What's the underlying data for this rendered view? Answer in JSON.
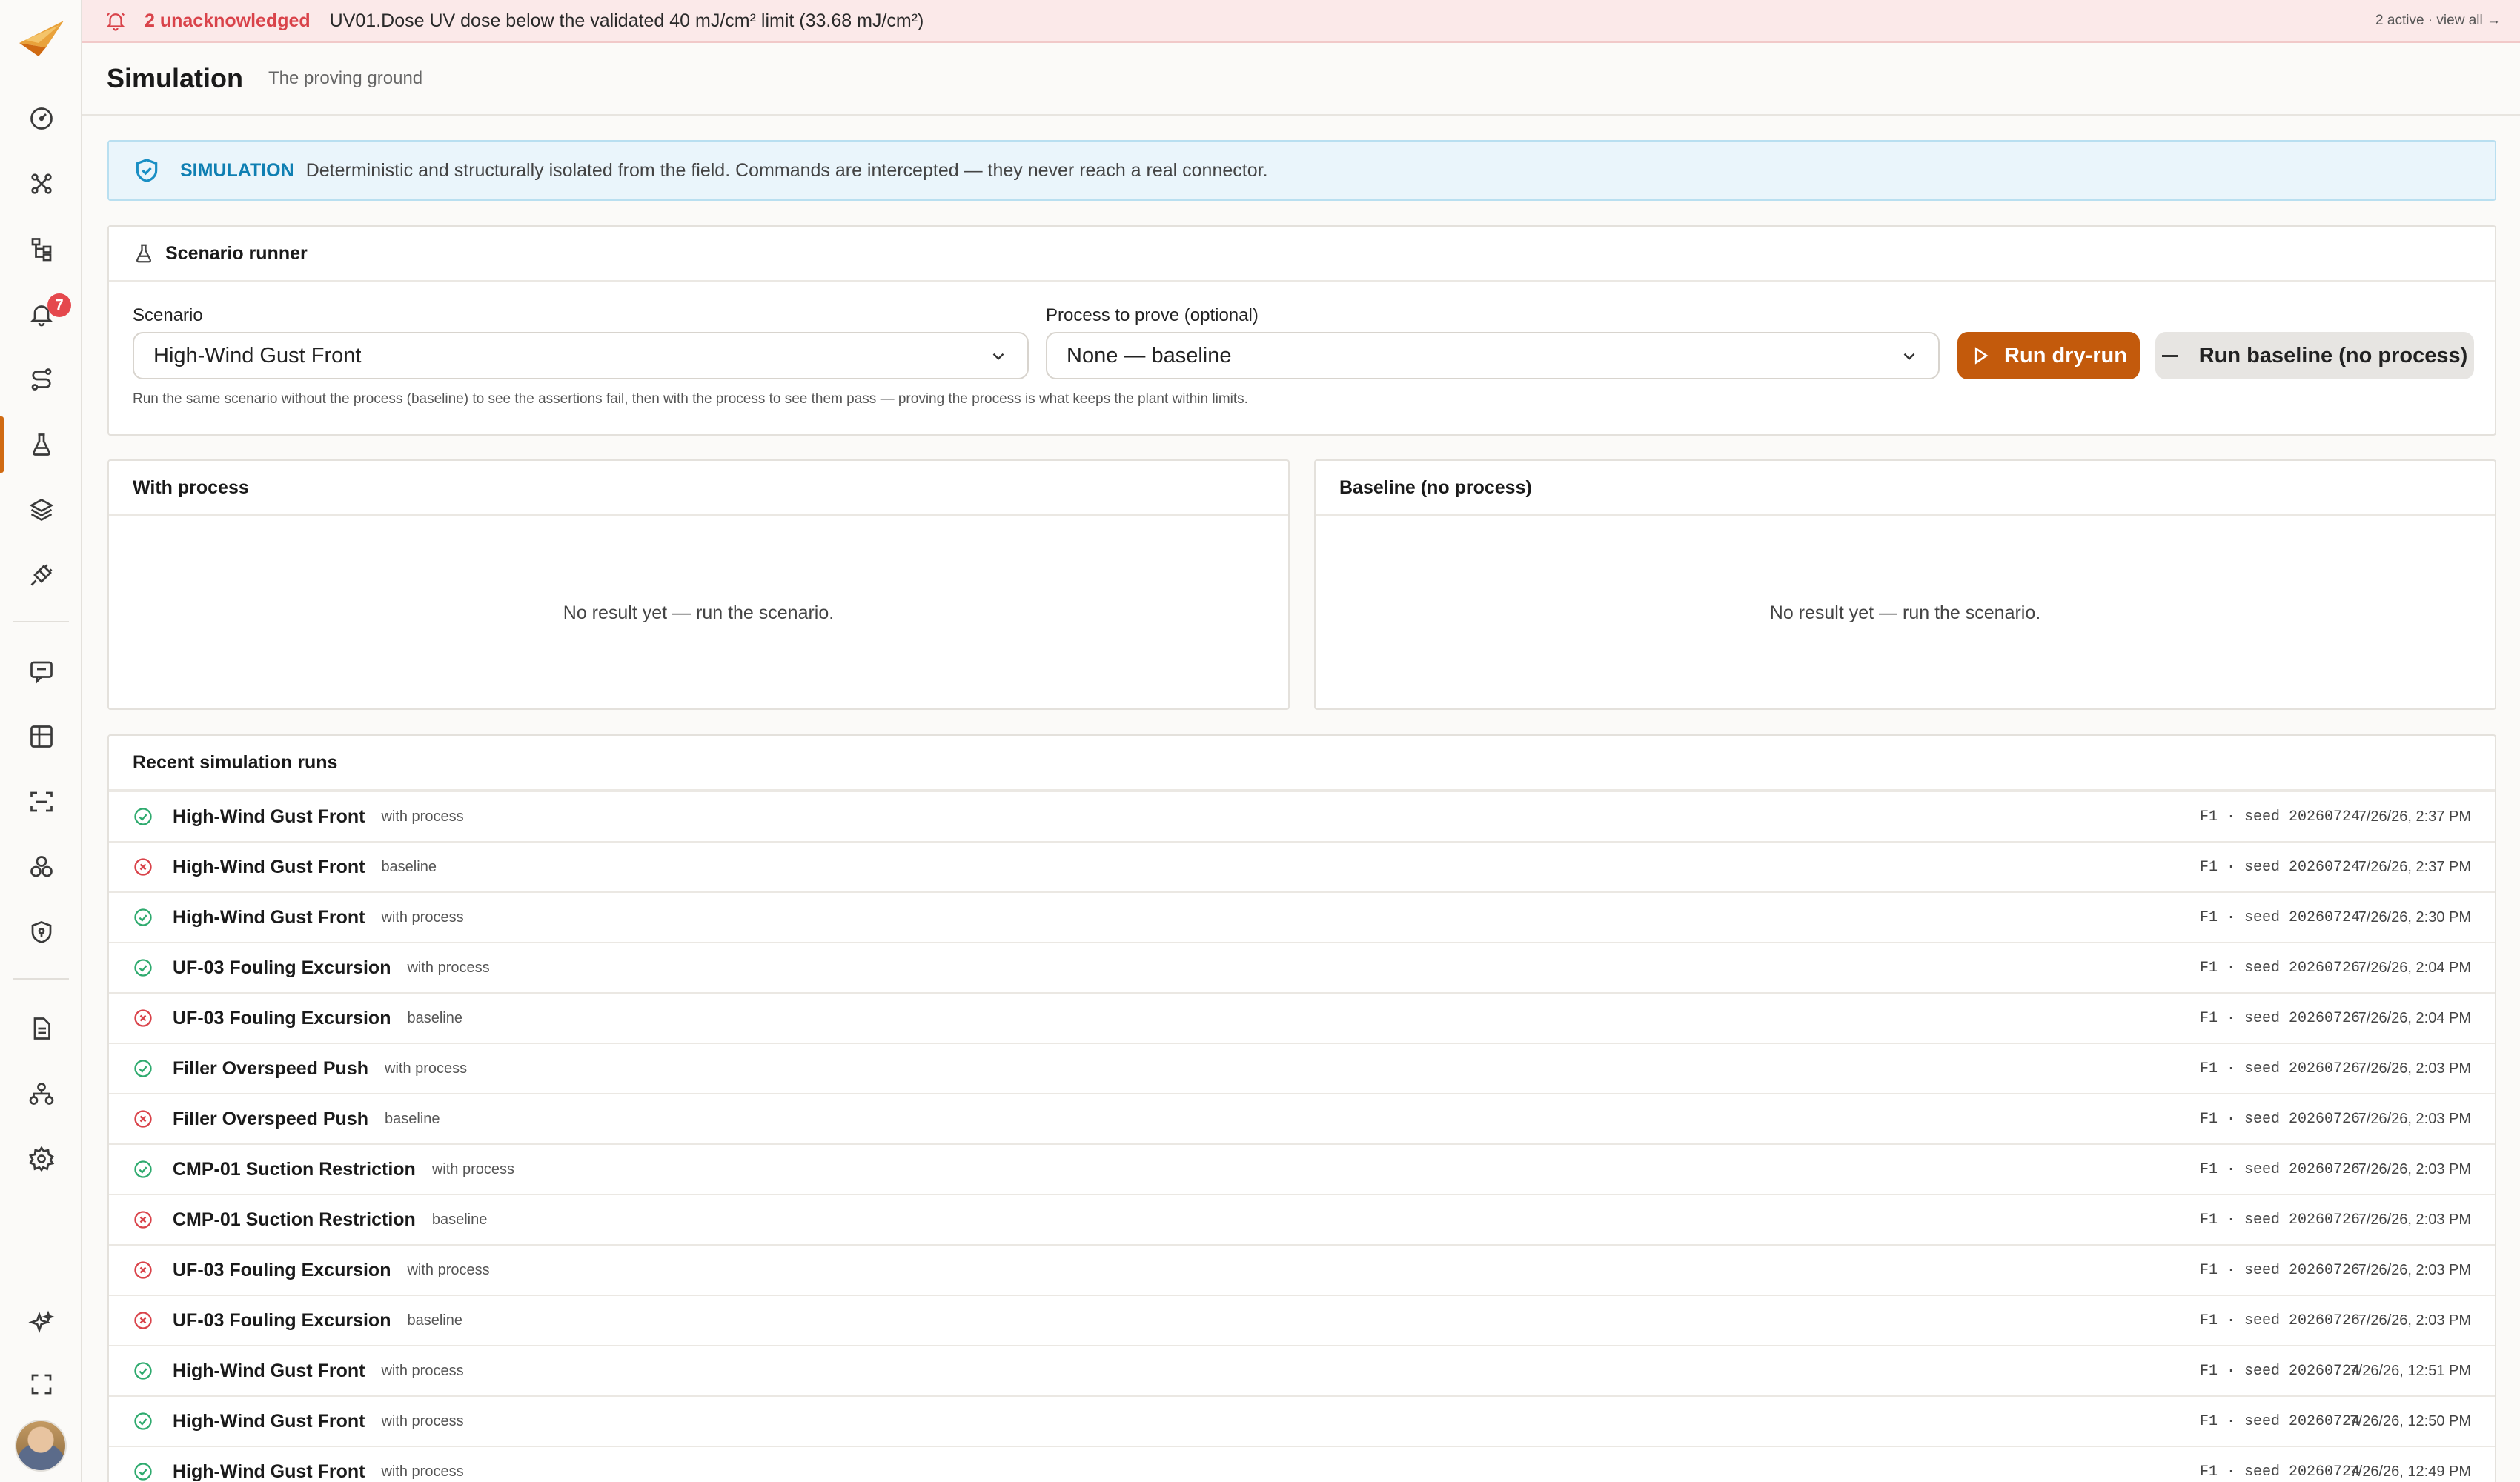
{
  "alert": {
    "count_label": "2 unacknowledged",
    "message": "UV01.Dose UV dose below the validated 40 mJ/cm² limit (33.68 mJ/cm²)",
    "right_label": "2 active · view all →"
  },
  "sidebar": {
    "items": [
      {
        "name": "dashboard",
        "icon": "gauge-icon"
      },
      {
        "name": "topology",
        "icon": "network-icon"
      },
      {
        "name": "process-tree",
        "icon": "hierarchy-icon"
      },
      {
        "name": "alarms",
        "icon": "bell-icon",
        "badge": "7"
      },
      {
        "name": "routes",
        "icon": "route-icon"
      },
      {
        "name": "simulation",
        "icon": "flask-icon",
        "active": true
      },
      {
        "name": "layers",
        "icon": "layers-icon"
      },
      {
        "name": "connectors",
        "icon": "plug-icon"
      },
      {
        "name": "chat",
        "icon": "chat-icon"
      },
      {
        "name": "tables",
        "icon": "grid-icon"
      },
      {
        "name": "scan",
        "icon": "scan-icon"
      },
      {
        "name": "components",
        "icon": "cubes-icon"
      },
      {
        "name": "security",
        "icon": "shield-icon"
      },
      {
        "name": "documents",
        "icon": "document-icon"
      },
      {
        "name": "org",
        "icon": "org-icon"
      },
      {
        "name": "settings",
        "icon": "gear-icon"
      },
      {
        "name": "ai",
        "icon": "sparkle-icon"
      },
      {
        "name": "fullscreen",
        "icon": "expand-icon"
      }
    ]
  },
  "header": {
    "title": "Simulation",
    "subtitle": "The proving ground"
  },
  "banner": {
    "tag": "SIMULATION",
    "text": "Deterministic and structurally isolated from the field. Commands are intercepted — they never reach a real connector."
  },
  "runner": {
    "title": "Scenario runner",
    "scenario_label": "Scenario",
    "scenario_value": "High-Wind Gust Front",
    "process_label": "Process to prove (optional)",
    "process_value": "None — baseline",
    "run_label": "Run dry-run",
    "baseline_label": "Run baseline (no process)",
    "hint": "Run the same scenario without the process (baseline) to see the assertions fail, then with the process to see them pass — proving the process is what keeps the plant within limits."
  },
  "with_process": {
    "title": "With process",
    "empty": "No result yet — run the scenario."
  },
  "baseline": {
    "title": "Baseline (no process)",
    "empty": "No result yet — run the scenario."
  },
  "runs": {
    "title": "Recent simulation runs",
    "rows": [
      {
        "status": "pass",
        "name": "High-Wind Gust Front",
        "mode": "with process",
        "seed": "F1 · seed 20260724",
        "time": "7/26/26, 2:37 PM"
      },
      {
        "status": "fail",
        "name": "High-Wind Gust Front",
        "mode": "baseline",
        "seed": "F1 · seed 20260724",
        "time": "7/26/26, 2:37 PM"
      },
      {
        "status": "pass",
        "name": "High-Wind Gust Front",
        "mode": "with process",
        "seed": "F1 · seed 20260724",
        "time": "7/26/26, 2:30 PM"
      },
      {
        "status": "pass",
        "name": "UF-03 Fouling Excursion",
        "mode": "with process",
        "seed": "F1 · seed 20260726",
        "time": "7/26/26, 2:04 PM"
      },
      {
        "status": "fail",
        "name": "UF-03 Fouling Excursion",
        "mode": "baseline",
        "seed": "F1 · seed 20260726",
        "time": "7/26/26, 2:04 PM"
      },
      {
        "status": "pass",
        "name": "Filler Overspeed Push",
        "mode": "with process",
        "seed": "F1 · seed 20260726",
        "time": "7/26/26, 2:03 PM"
      },
      {
        "status": "fail",
        "name": "Filler Overspeed Push",
        "mode": "baseline",
        "seed": "F1 · seed 20260726",
        "time": "7/26/26, 2:03 PM"
      },
      {
        "status": "pass",
        "name": "CMP-01 Suction Restriction",
        "mode": "with process",
        "seed": "F1 · seed 20260726",
        "time": "7/26/26, 2:03 PM"
      },
      {
        "status": "fail",
        "name": "CMP-01 Suction Restriction",
        "mode": "baseline",
        "seed": "F1 · seed 20260726",
        "time": "7/26/26, 2:03 PM"
      },
      {
        "status": "fail",
        "name": "UF-03 Fouling Excursion",
        "mode": "with process",
        "seed": "F1 · seed 20260726",
        "time": "7/26/26, 2:03 PM"
      },
      {
        "status": "fail",
        "name": "UF-03 Fouling Excursion",
        "mode": "baseline",
        "seed": "F1 · seed 20260726",
        "time": "7/26/26, 2:03 PM"
      },
      {
        "status": "pass",
        "name": "High-Wind Gust Front",
        "mode": "with process",
        "seed": "F1 · seed 20260724",
        "time": "7/26/26, 12:51 PM"
      },
      {
        "status": "pass",
        "name": "High-Wind Gust Front",
        "mode": "with process",
        "seed": "F1 · seed 20260724",
        "time": "7/26/26, 12:50 PM"
      },
      {
        "status": "pass",
        "name": "High-Wind Gust Front",
        "mode": "with process",
        "seed": "F1 · seed 20260724",
        "time": "7/26/26, 12:49 PM"
      }
    ]
  },
  "colors": {
    "accent": "#c35a0c",
    "pass": "#2eaa6e",
    "fail": "#d9434a",
    "info": "#0f7fb2"
  }
}
